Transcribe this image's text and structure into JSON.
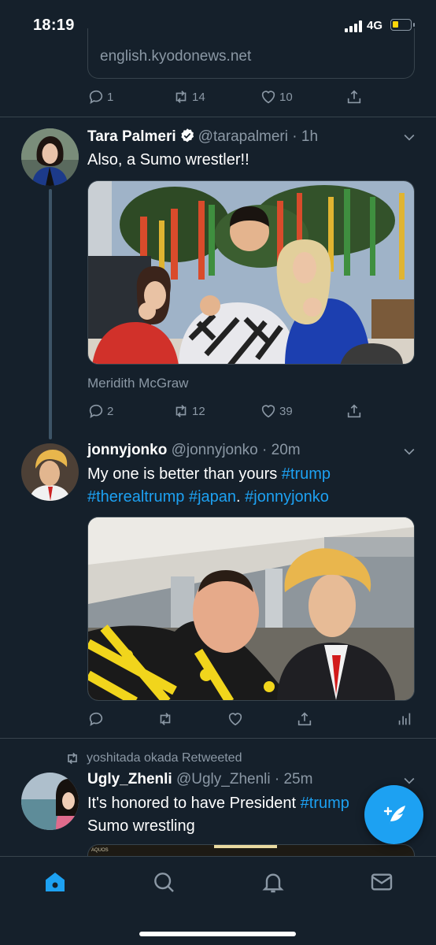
{
  "status_bar": {
    "time": "18:19",
    "network": "4G",
    "battery_level": 0.25
  },
  "link_card": {
    "domain": "english.kyodonews.net"
  },
  "tweet0": {
    "replies": "1",
    "retweets": "14",
    "likes": "10"
  },
  "tweet1": {
    "name": "Tara Palmeri",
    "handle": "@tarapalmeri",
    "time": "1h",
    "text": "Also, a Sumo wrestler!!",
    "caption": "Meridith McGraw",
    "replies": "2",
    "retweets": "12",
    "likes": "39"
  },
  "tweet2": {
    "name": "jonnyjonko",
    "handle": "@jonnyjonko",
    "time": "20m",
    "text_plain": "My one is better than yours ",
    "tag1": "#trump",
    "tag2": "#therealtrump",
    "tag3": "#japan",
    "sep": ". ",
    "tag4": "#jonnyjonko"
  },
  "tweet3": {
    "retweeted_by": "yoshitada okada Retweeted",
    "name": "Ugly_Zhenli",
    "handle": "@Ugly_Zhenli",
    "time": "25m",
    "text_plain": "It's honored to have President ",
    "tag1": "#trump",
    "text_line2": "Sumo wrestling",
    "media_label": "AQUOS"
  },
  "colors": {
    "background": "#15202b",
    "accent": "#1da1f2",
    "secondary_text": "#8b98a5",
    "divider": "#38444d"
  },
  "icons": [
    "reply-icon",
    "retweet-icon",
    "like-icon",
    "share-icon",
    "analytics-icon",
    "verified-icon",
    "chevron-down-icon",
    "compose-icon",
    "home-icon",
    "search-icon",
    "notifications-icon",
    "messages-icon"
  ]
}
